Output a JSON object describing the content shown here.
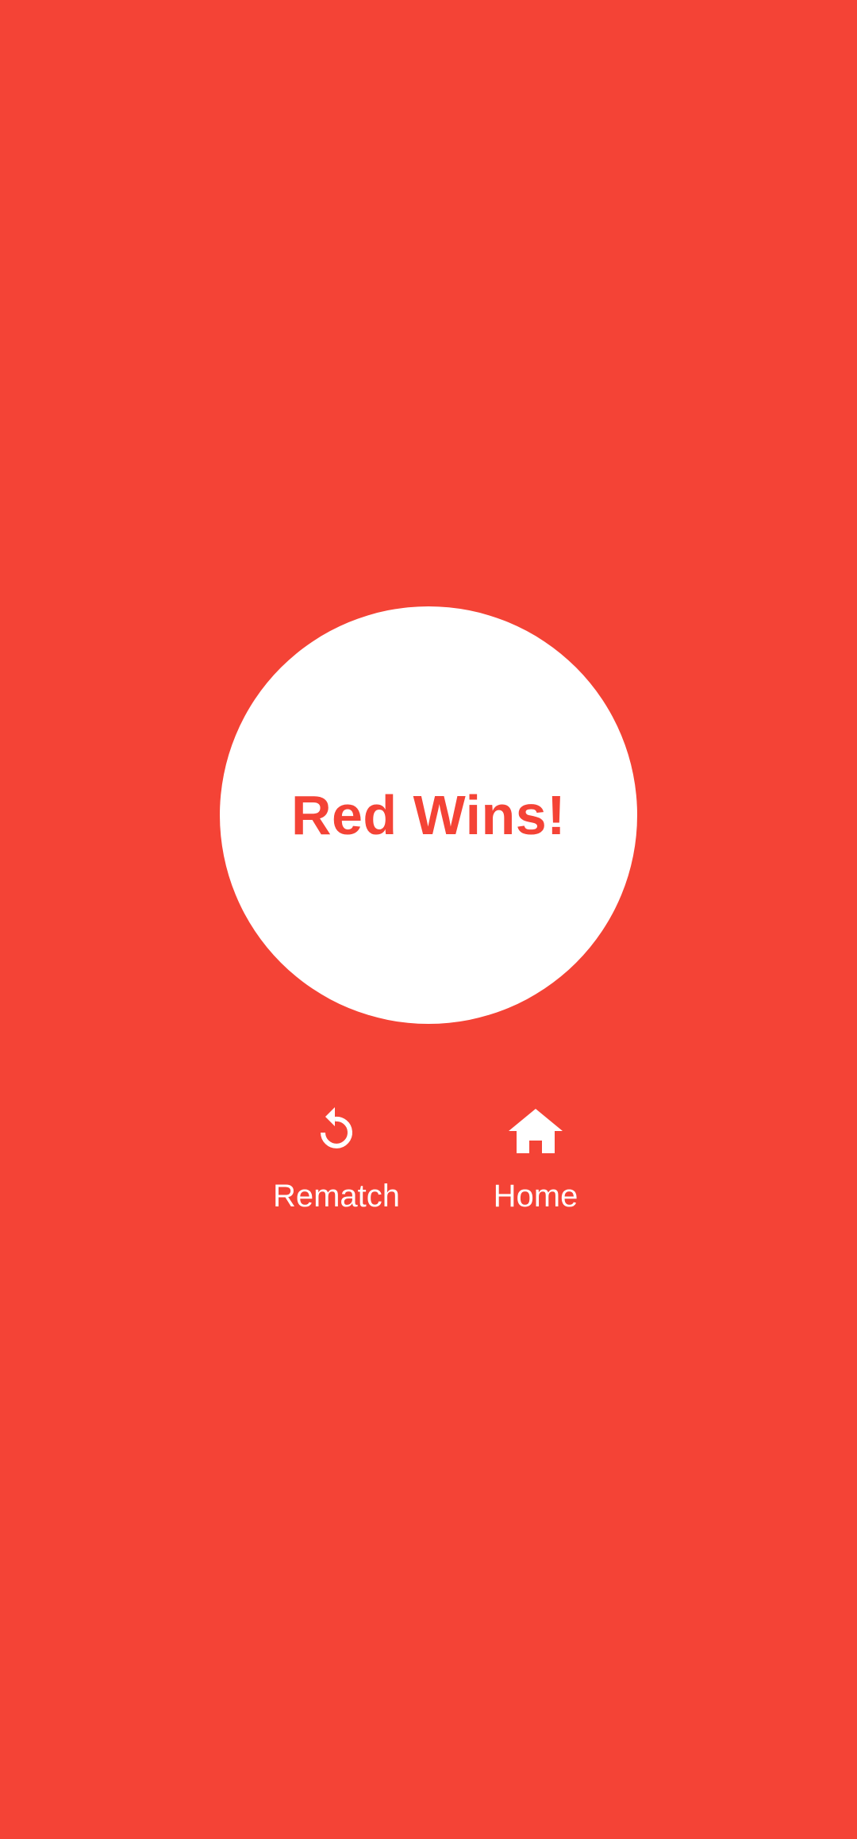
{
  "theme": {
    "background": "#F44336",
    "accent": "#F44336",
    "foreground": "#FFFFFF"
  },
  "result": {
    "text": "Red Wins!"
  },
  "actions": [
    {
      "label": "Rematch",
      "icon": "restart-icon"
    },
    {
      "label": "Home",
      "icon": "home-icon"
    }
  ]
}
